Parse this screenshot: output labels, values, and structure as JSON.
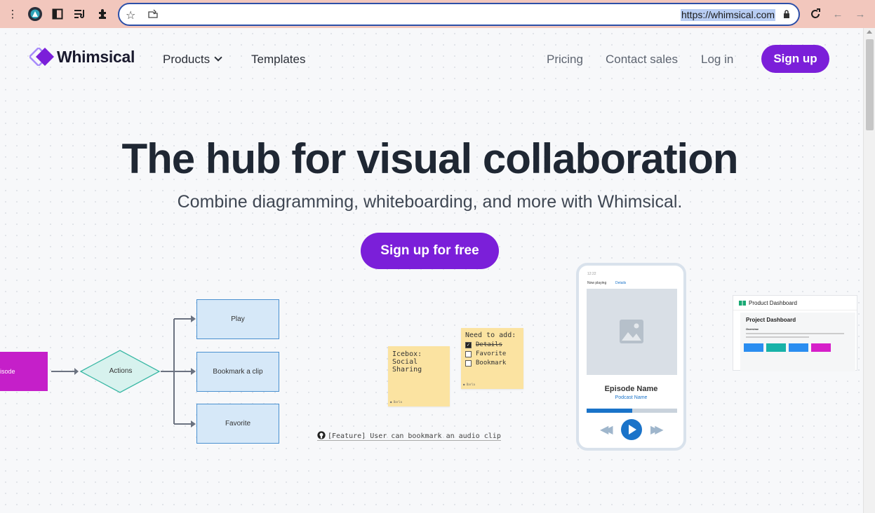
{
  "browser": {
    "url": "https://whimsical.com",
    "icons": [
      "more-vert-icon",
      "profile-avatar-icon",
      "sidebar-icon",
      "reading-list-icon",
      "extensions-icon",
      "bookmark-star-icon",
      "share-icon",
      "lock-icon",
      "reload-icon",
      "back-arrow-icon",
      "forward-arrow-icon"
    ]
  },
  "nav": {
    "brand": "Whimsical",
    "products": "Products",
    "templates": "Templates",
    "pricing": "Pricing",
    "contact_sales": "Contact sales",
    "login": "Log in",
    "signup": "Sign up"
  },
  "hero": {
    "title": "The hub for visual collaboration",
    "subtitle": "Combine diagramming, whiteboarding, and more with Whimsical.",
    "cta": "Sign up for free"
  },
  "flowchart": {
    "start": "isode",
    "decision": "Actions",
    "options": [
      "Play",
      "Bookmark a clip",
      "Favorite"
    ]
  },
  "stickies": {
    "icebox_title": "Icebox:",
    "icebox_body": "Social Sharing",
    "icebox_author": "Darla",
    "todo_title": "Need to add:",
    "todo_items": [
      {
        "label": "Details",
        "checked": true
      },
      {
        "label": "Favorite",
        "checked": false
      },
      {
        "label": "Bookmark",
        "checked": false
      }
    ],
    "todo_author": "Darla"
  },
  "ticket": "[Feature] User can bookmark an audio clip",
  "phone": {
    "time": "12:22",
    "tab_now_playing": "Now playing",
    "tab_details": "Details",
    "episode": "Episode Name",
    "podcast": "Podcast Name",
    "progress": 0.5
  },
  "dashboard": {
    "header": "Product Dashboard",
    "title": "Project Dashboard",
    "overview": "Overview",
    "tasks": "Tasks",
    "col_colors": [
      "#2a8df0",
      "#18b2a8",
      "#2a8df0",
      "#d61fc9"
    ]
  },
  "colors": {
    "brand_purple": "#7b1fd9",
    "flow_magenta": "#c51fc9",
    "flow_teal": "#d7f2ee",
    "flow_blue": "#d6e8f8",
    "sticky_yellow": "#fbe3a1",
    "accent_blue": "#1a73c9"
  }
}
